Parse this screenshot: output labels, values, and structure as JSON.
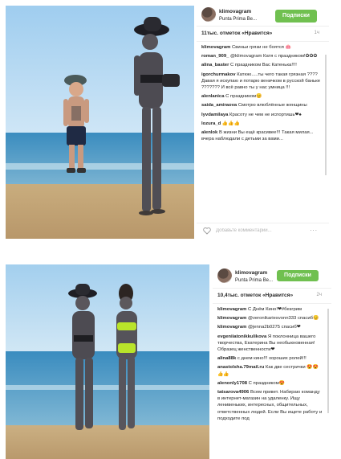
{
  "post1": {
    "username": "klimovagram",
    "location": "Punta Prima Be...",
    "follow_label": "Подписки",
    "likes": "11тыс. отметок «Нравится»",
    "time": "1ч",
    "add_comment_placeholder": "Добавьте комментарий...",
    "more": "...",
    "comments": [
      {
        "user": "klimovagram",
        "text": "Свиньи грязи не боятся 🐽"
      },
      {
        "user": "roman_909_",
        "text": "@klimovagram Катя с праздником!✿✿✿"
      },
      {
        "user": "alina_baster",
        "text": "С праздником Вас Катенька!!!!"
      },
      {
        "user": "igorchurmakov",
        "text": "Катюю.....ты чего такая грязная ???? Давая я искупаю и потарю веничком в русской баньке ??????? И всё равно ты у нас умница !!!"
      },
      {
        "user": "alenlanica",
        "text": "С праздником😊"
      },
      {
        "user": "saida_amiraova",
        "text": "Смотрю влюблённые женщины"
      },
      {
        "user": "lyvdamilaya",
        "text": "Красоту не чем не испортишь❤♠"
      },
      {
        "user": "lozura_d",
        "text": "👍👍👍"
      },
      {
        "user": "alenlok",
        "text": "В жизни Вы ещё красивее!!! Такая милая... вчера наблюдали с детьми за вами..."
      }
    ]
  },
  "post2": {
    "username": "klimovagram",
    "location": "Punta Prima Be...",
    "follow_label": "Подписки",
    "likes": "10,4тыс. отметок «Нравится»",
    "time": "2ч",
    "comments": [
      {
        "user": "klimovagram",
        "text": "С Днём Кино!❤#безгрим"
      },
      {
        "user": "klimovagram",
        "text": "@veronikariesvonn333 спасиб😊"
      },
      {
        "user": "klimovagram",
        "text": "@jenna2b0275 спасиб❤"
      },
      {
        "user": "evgeniiatonikkulikova",
        "text": "Я поклонница вашего творчества, Екатерина Вы необыкновенная! Образец женственности❤"
      },
      {
        "user": "alina88k",
        "text": "с днем кино!!! хороших ролей!!!"
      },
      {
        "user": "anastolsha.79mail.ru",
        "text": "Как две сестрички 😍😍👍👍"
      },
      {
        "user": "alenonly1708",
        "text": "С праздником😍"
      },
      {
        "user": "tatsarova4906",
        "text": "Всем привет. Набираю команду в интернет-магазин на удаленку. Ищу ленивеньких, интересных, общительных, ответственных людей. Если Вы ищете работу и подходите под"
      }
    ]
  },
  "colors": {
    "follow_bg": "#70c050",
    "sky": "#aed2ee",
    "sea": "#3f8fbe",
    "sand": "#cdb48a"
  }
}
